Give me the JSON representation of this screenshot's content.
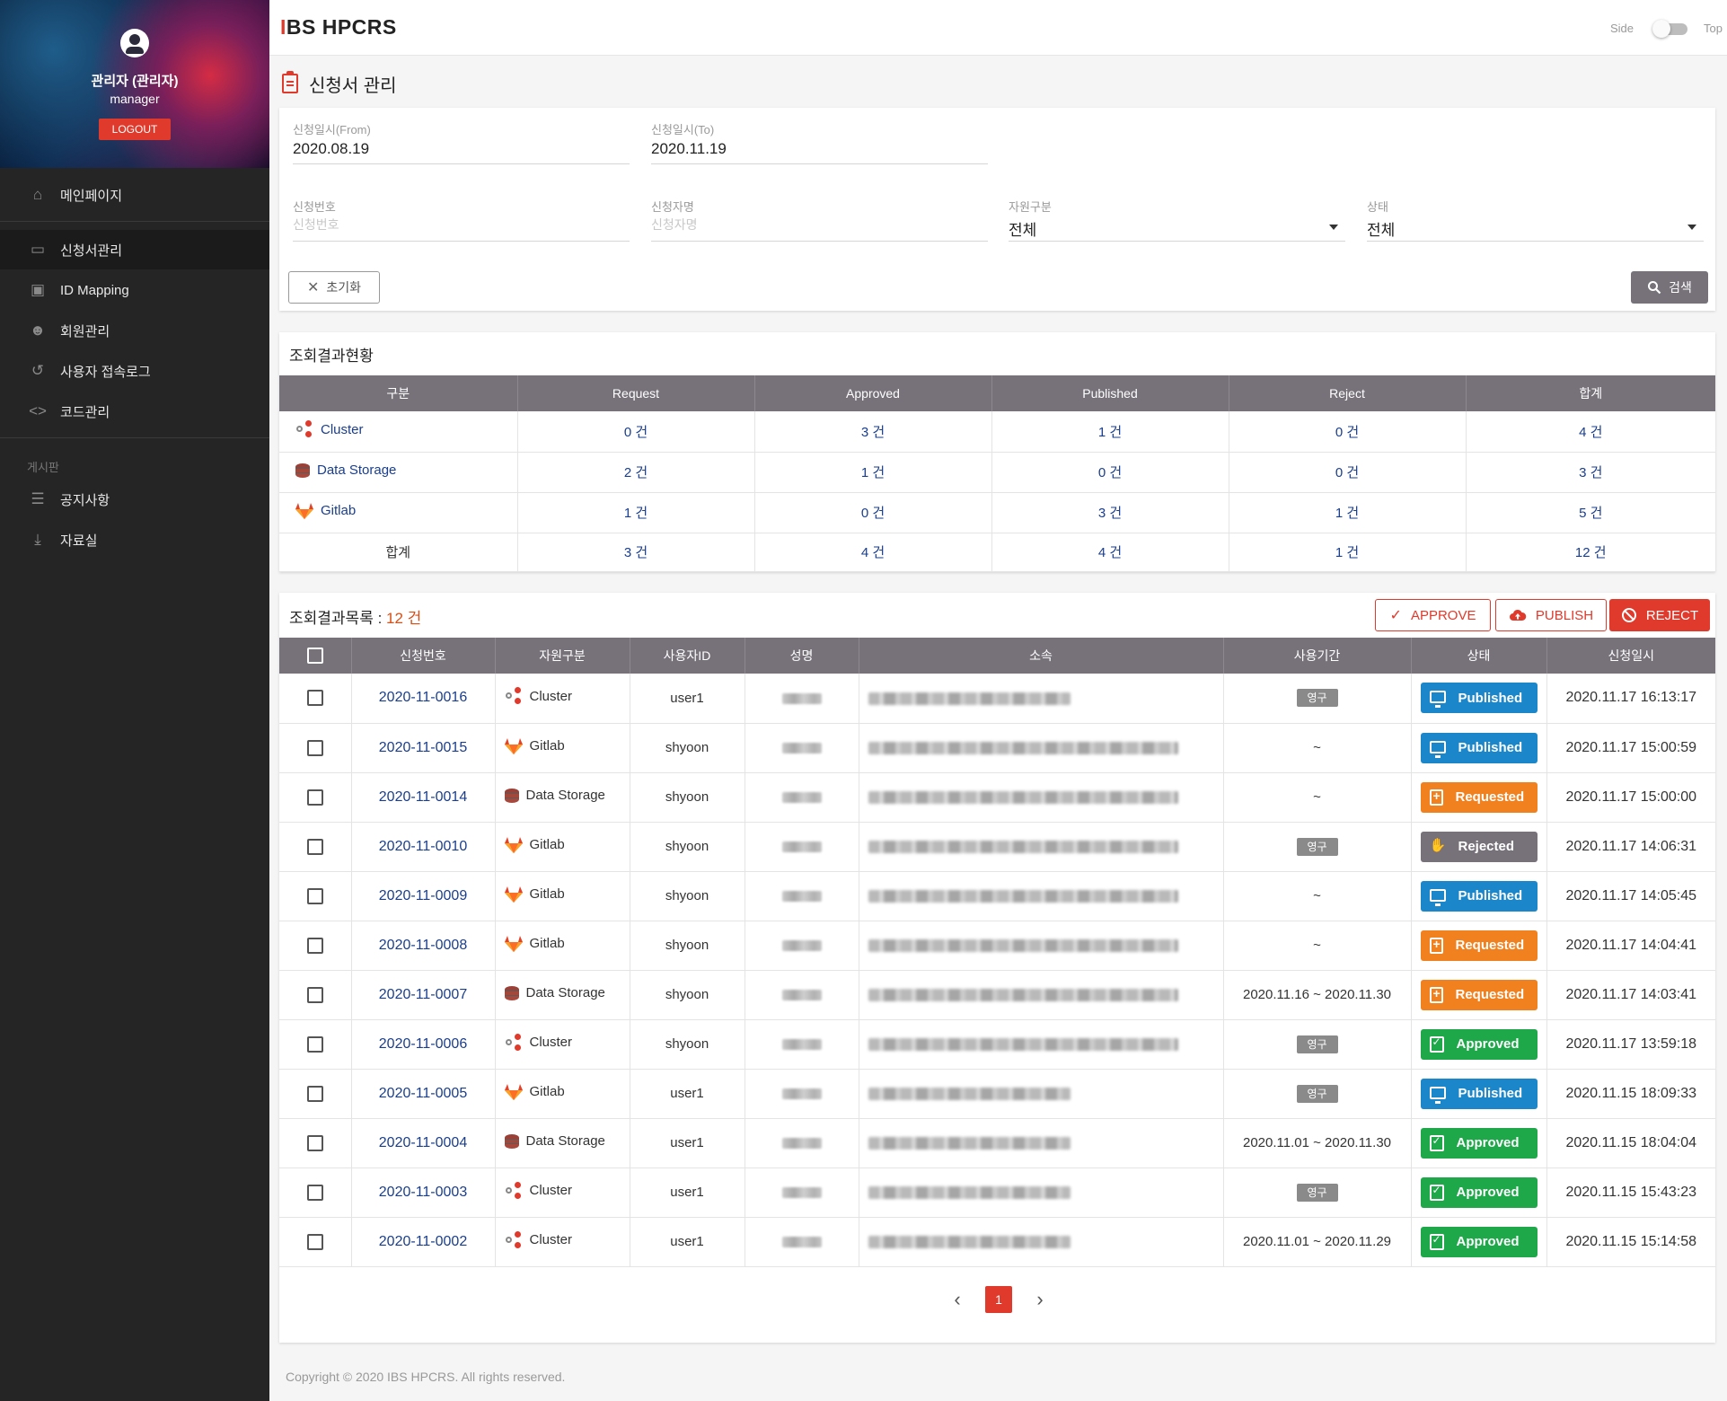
{
  "sidebar": {
    "profile": {
      "name": "관리자 (관리자)",
      "role": "manager",
      "logout_label": "LOGOUT"
    },
    "items": [
      {
        "label": "메인페이지",
        "icon": "home-icon"
      },
      {
        "label": "신청서관리",
        "icon": "clipboard-icon"
      },
      {
        "label": "ID Mapping",
        "icon": "id-badge-icon"
      },
      {
        "label": "회원관리",
        "icon": "users-icon"
      },
      {
        "label": "사용자 접속로그",
        "icon": "history-icon"
      },
      {
        "label": "코드관리",
        "icon": "code-icon"
      }
    ],
    "board_section": "게시판",
    "board_items": [
      {
        "label": "공지사항",
        "icon": "notice-icon"
      },
      {
        "label": "자료실",
        "icon": "download-icon"
      }
    ]
  },
  "header": {
    "brand_accent": "I",
    "brand_rest": "BS HPCRS",
    "toggle_side": "Side",
    "toggle_top": "Top"
  },
  "page": {
    "title": "신청서 관리"
  },
  "filters": {
    "from": {
      "label": "신청일시(From)",
      "value": "2020.08.19"
    },
    "to": {
      "label": "신청일시(To)",
      "value": "2020.11.19"
    },
    "request_no": {
      "label": "신청번호",
      "placeholder": "신청번호"
    },
    "applicant": {
      "label": "신청자명",
      "placeholder": "신청자명"
    },
    "resource_type": {
      "label": "자원구분",
      "value": "전체"
    },
    "state": {
      "label": "상태",
      "value": "전체"
    },
    "reset_label": "초기화",
    "search_label": "검색"
  },
  "summary": {
    "title": "조회결과현황",
    "headers": [
      "구분",
      "Request",
      "Approved",
      "Published",
      "Reject",
      "합계"
    ],
    "rows": [
      {
        "type": "Cluster",
        "icon": "cluster-icon",
        "values": [
          "0 건",
          "3 건",
          "1 건",
          "0 건",
          "4 건"
        ]
      },
      {
        "type": "Data Storage",
        "icon": "storage-icon",
        "values": [
          "2 건",
          "1 건",
          "0 건",
          "0 건",
          "3 건"
        ]
      },
      {
        "type": "Gitlab",
        "icon": "gitlab-icon",
        "values": [
          "1 건",
          "0 건",
          "3 건",
          "1 건",
          "5 건"
        ]
      }
    ],
    "total": {
      "label": "합계",
      "values": [
        "3 건",
        "4 건",
        "4 건",
        "1 건",
        "12 건"
      ]
    }
  },
  "list": {
    "title": "조회결과목록 : ",
    "count": "12 건",
    "approve_label": "APPROVE",
    "publish_label": "PUBLISH",
    "reject_label": "REJECT",
    "headers": [
      "신청번호",
      "자원구분",
      "사용자ID",
      "성명",
      "소속",
      "사용기간",
      "상태",
      "신청일시"
    ],
    "rows": [
      {
        "no": "2020-11-0016",
        "type": "Cluster",
        "user": "user1",
        "period": "영구",
        "status": "Published",
        "date": "2020.11.17 16:13:17"
      },
      {
        "no": "2020-11-0015",
        "type": "Gitlab",
        "user": "shyoon",
        "period": "~",
        "status": "Published",
        "date": "2020.11.17 15:00:59"
      },
      {
        "no": "2020-11-0014",
        "type": "Data Storage",
        "user": "shyoon",
        "period": "~",
        "status": "Requested",
        "date": "2020.11.17 15:00:00"
      },
      {
        "no": "2020-11-0010",
        "type": "Gitlab",
        "user": "shyoon",
        "period": "영구",
        "status": "Rejected",
        "date": "2020.11.17 14:06:31"
      },
      {
        "no": "2020-11-0009",
        "type": "Gitlab",
        "user": "shyoon",
        "period": "~",
        "status": "Published",
        "date": "2020.11.17 14:05:45"
      },
      {
        "no": "2020-11-0008",
        "type": "Gitlab",
        "user": "shyoon",
        "period": "~",
        "status": "Requested",
        "date": "2020.11.17 14:04:41"
      },
      {
        "no": "2020-11-0007",
        "type": "Data Storage",
        "user": "shyoon",
        "period": "2020.11.16 ~ 2020.11.30",
        "status": "Requested",
        "date": "2020.11.17 14:03:41"
      },
      {
        "no": "2020-11-0006",
        "type": "Cluster",
        "user": "shyoon",
        "period": "영구",
        "status": "Approved",
        "date": "2020.11.17 13:59:18"
      },
      {
        "no": "2020-11-0005",
        "type": "Gitlab",
        "user": "user1",
        "period": "영구",
        "status": "Published",
        "date": "2020.11.15 18:09:33"
      },
      {
        "no": "2020-11-0004",
        "type": "Data Storage",
        "user": "user1",
        "period": "2020.11.01 ~ 2020.11.30",
        "status": "Approved",
        "date": "2020.11.15 18:04:04"
      },
      {
        "no": "2020-11-0003",
        "type": "Cluster",
        "user": "user1",
        "period": "영구",
        "status": "Approved",
        "date": "2020.11.15 15:43:23"
      },
      {
        "no": "2020-11-0002",
        "type": "Cluster",
        "user": "user1",
        "period": "2020.11.01 ~ 2020.11.29",
        "status": "Approved",
        "date": "2020.11.15 15:14:58"
      }
    ]
  },
  "pagination": {
    "current": "1"
  },
  "footer": "Copyright © 2020 IBS HPCRS. All rights reserved.",
  "colors": {
    "accent": "#e03a2c",
    "published": "#1b86c9",
    "requested": "#f1811e",
    "approved": "#1fa84a",
    "rejected": "#77717a",
    "header_bg": "#77717a",
    "link": "#1a3e8c"
  }
}
